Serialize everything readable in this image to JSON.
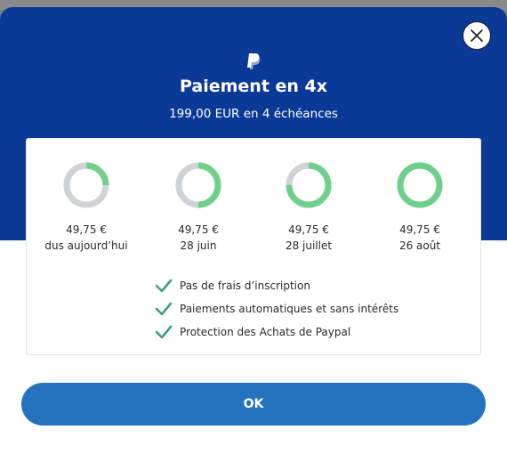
{
  "modal": {
    "title": "Paiement en 4x",
    "subtitle": "199,00 EUR en 4 échéances",
    "close_icon": "close-icon",
    "logo_icon": "paypal-logo"
  },
  "installments": [
    {
      "amount": "49,75 €",
      "due": "dus aujourd’hui",
      "progress": 0.25
    },
    {
      "amount": "49,75 €",
      "due": "28 juin",
      "progress": 0.5
    },
    {
      "amount": "49,75 €",
      "due": "28 juillet",
      "progress": 0.75
    },
    {
      "amount": "49,75 €",
      "due": "26 août",
      "progress": 1.0
    }
  ],
  "features": [
    {
      "label": "Pas de frais d’inscription",
      "icon": "check-icon"
    },
    {
      "label": "Paiements automatiques et sans intérêts",
      "icon": "check-icon"
    },
    {
      "label": "Protection des Achats de Paypal",
      "icon": "check-icon"
    }
  ],
  "actions": {
    "ok_label": "OK"
  },
  "colors": {
    "header": "#0b3a96",
    "progress": "#6fd08c",
    "track": "#cfd3d8",
    "check": "#3f9f87",
    "button": "#2572bf"
  }
}
